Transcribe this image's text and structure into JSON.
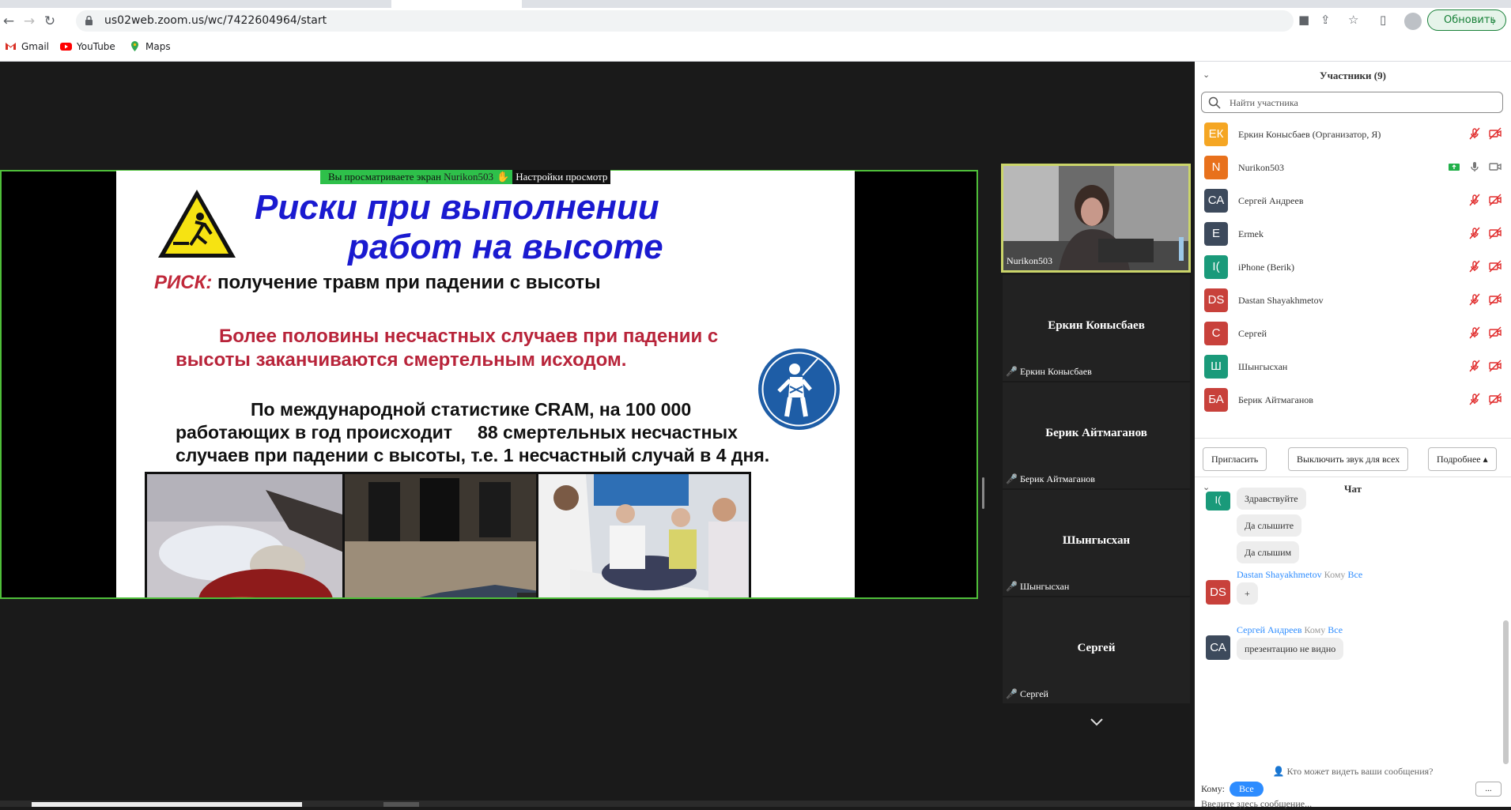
{
  "browser": {
    "url": "us02web.zoom.us/wc/7422604964/start",
    "update_label": "Обновить",
    "bookmarks": [
      {
        "label": "Gmail",
        "icon": "gmail-icon"
      },
      {
        "label": "YouTube",
        "icon": "youtube-icon"
      },
      {
        "label": "Maps",
        "icon": "maps-icon"
      }
    ]
  },
  "share": {
    "viewing_prefix": "Вы просматриваете экран",
    "viewing_name": "Nurikon503",
    "settings_label": "Настройки просмотр"
  },
  "slide": {
    "title_line1": "Риски при выполнении",
    "title_line2": "работ на высоте",
    "risk_word": "РИСК:",
    "risk_text": "получение травм при падении с высоты",
    "red_line1": "Более половины несчастных случаев при падении с",
    "red_line2": "высоты заканчиваются смертельным исходом.",
    "stat_line1": "По международной статистике CRAM, на 100 000",
    "stat_line2": "работающих в год происходит     88 смертельных несчастных",
    "stat_line3": "случаев при падении с высоты, т.е. 1 несчастный случай в 4 дня."
  },
  "gallery": {
    "speaker_name": "Nurikon503",
    "tiles": [
      {
        "big": "Еркин Конысбаев",
        "small": "Еркин Конысбаев"
      },
      {
        "big": "Берик Айтмаганов",
        "small": "Берик Айтмаганов"
      },
      {
        "big": "Шынгысхан",
        "small": "Шынгысхан"
      },
      {
        "big": "Сергей",
        "small": "Сергей"
      }
    ]
  },
  "participants": {
    "header": "Участники (9)",
    "search_placeholder": "Найти участника",
    "list": [
      {
        "initials": "ЕК",
        "name": "Еркин Конысбаев (Организатор, Я)",
        "color": "#f5a623"
      },
      {
        "initials": "N",
        "name": "Nurikon503",
        "color": "#e8711c"
      },
      {
        "initials": "СА",
        "name": "Сергей Андреев",
        "color": "#3d4a5c"
      },
      {
        "initials": "E",
        "name": "Ermek",
        "color": "#3d4a5c"
      },
      {
        "initials": "I(",
        "name": "iPhone (Berik)",
        "color": "#1a9a7a"
      },
      {
        "initials": "DS",
        "name": "Dastan Shayakhmetov",
        "color": "#c8413b"
      },
      {
        "initials": "С",
        "name": "Сергей",
        "color": "#c8413b"
      },
      {
        "initials": "Ш",
        "name": "Шынгысхан",
        "color": "#1a9a7a"
      },
      {
        "initials": "БА",
        "name": "Берик Айтмаганов",
        "color": "#c8413b"
      }
    ],
    "invite_label": "Пригласить",
    "mute_all_label": "Выключить звук для всех",
    "more_label": "Подробнее ▴"
  },
  "chat": {
    "header": "Чат",
    "messages": [
      {
        "text": "Здравствуйте"
      },
      {
        "text": "Да слышите"
      },
      {
        "text": "Да слышим"
      }
    ],
    "msg2_sender": "Dastan Shayakhmetov",
    "msg2_to": "Кому",
    "msg2_all": "Все",
    "msg2_initials": "DS",
    "msg2_text": "+",
    "msg3_sender": "Сергей Андреев",
    "msg3_to": "Кому",
    "msg3_all": "Все",
    "msg3_initials": "СА",
    "msg3_text": "презентацию не видно",
    "first_initials": "I(",
    "who_can_see": "Кто может видеть ваши сообщения?",
    "to_label": "Кому:",
    "to_value": "Все",
    "more_dots": "...",
    "input_placeholder": "Введите здесь сообщение..."
  }
}
